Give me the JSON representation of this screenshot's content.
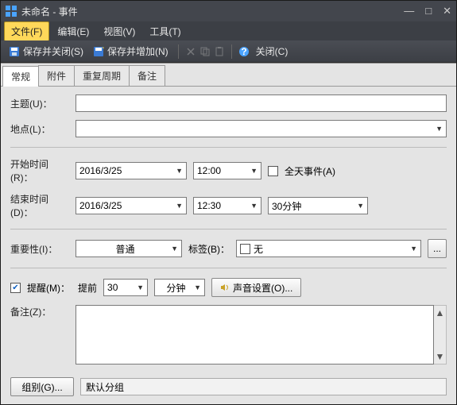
{
  "window": {
    "title": "未命名 - 事件"
  },
  "menu": {
    "file": "文件(F)",
    "edit": "编辑(E)",
    "view": "视图(V)",
    "tools": "工具(T)"
  },
  "toolbar": {
    "save_close": "保存并关闭(S)",
    "save_add": "保存并增加(N)",
    "close": "关闭(C)"
  },
  "tabs": {
    "general": "常规",
    "attach": "附件",
    "recur": "重复周期",
    "notetab": "备注"
  },
  "labels": {
    "subject": "主题(U)：",
    "location": "地点(L)：",
    "start": "开始时间(R)：",
    "end": "结束时间(D)：",
    "allday": "全天事件(A)",
    "importance": "重要性(I)：",
    "tag": "标签(B)：",
    "remind": "提醒(M)：",
    "before": "提前",
    "sound": "声音设置(O)...",
    "notes": "备注(Z)：",
    "group": "组别(G)..."
  },
  "values": {
    "subject": "",
    "location": "",
    "start_date": "2016/3/25",
    "start_time": "12:00",
    "end_date": "2016/3/25",
    "end_time": "12:30",
    "duration": "30分钟",
    "allday_checked": false,
    "importance": "普通",
    "tag": "无",
    "remind_checked": true,
    "remind_value": "30",
    "remind_unit": "分钟",
    "notes": "",
    "group": "默认分组"
  }
}
